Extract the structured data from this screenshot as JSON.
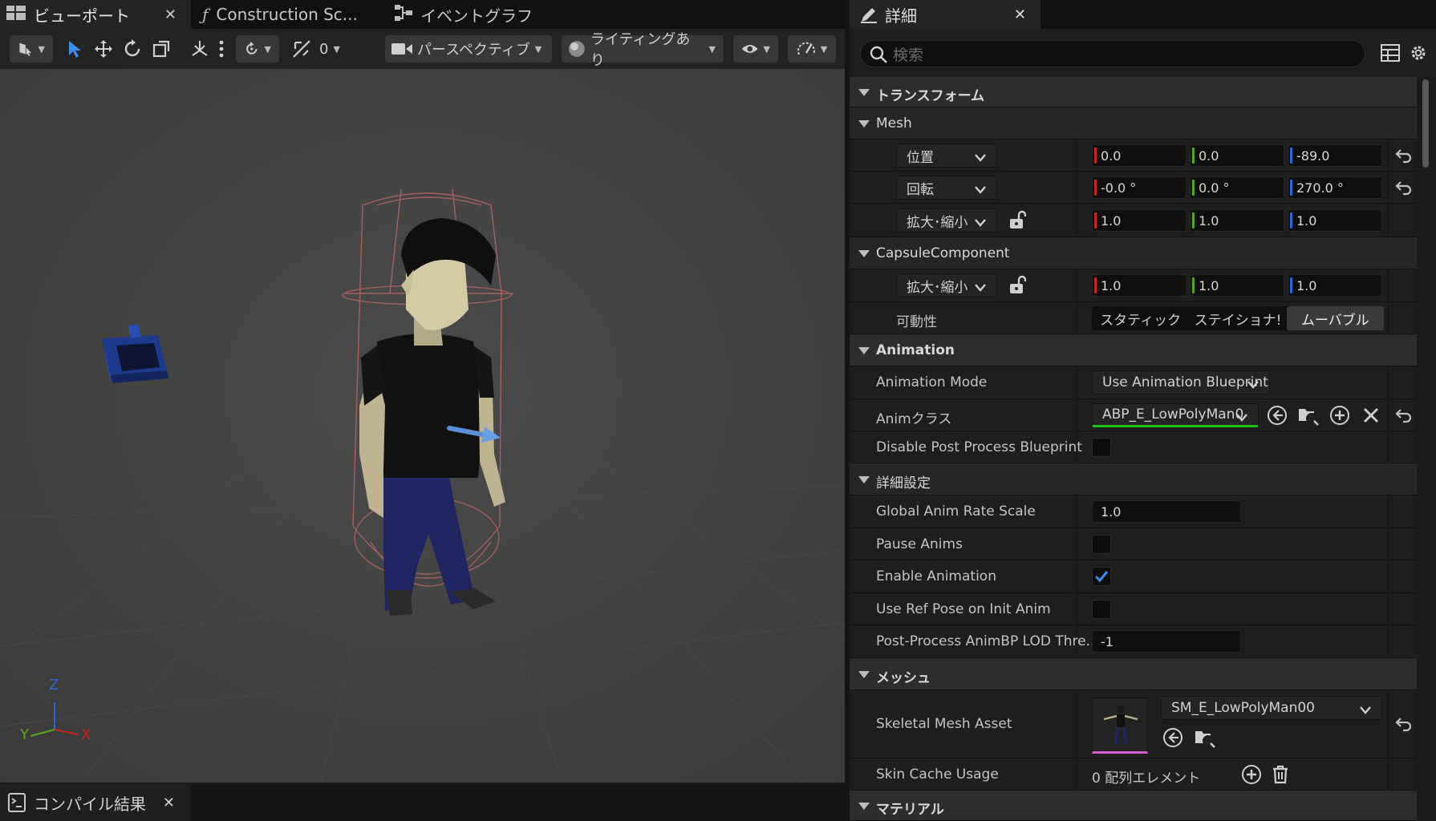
{
  "viewport_tabs": [
    {
      "label": "ビューポート"
    },
    {
      "label": "Construction Sc..."
    },
    {
      "label": "イベントグラフ"
    }
  ],
  "toolbar": {
    "snap_value": "0",
    "camera_mode": "パースペクティブ",
    "lighting_mode": "ライティングあり"
  },
  "axes": {
    "z": "Z",
    "y": "Y",
    "x": "X"
  },
  "bottom_tab": {
    "label": "コンパイル結果"
  },
  "details": {
    "tab_label": "詳細",
    "search_placeholder": "検索",
    "transform_section": "トランスフォーム",
    "mesh_sub": "Mesh",
    "location_label": "位置",
    "location": [
      "0.0",
      "0.0",
      "-89.0"
    ],
    "rotation_label": "回転",
    "rotation": [
      "-0.0 °",
      "0.0 °",
      "270.0 °"
    ],
    "scale_label": "拡大･縮小",
    "scale": [
      "1.0",
      "1.0",
      "1.0"
    ],
    "capsule_sub": "CapsuleComponent",
    "capsule_scale_label": "拡大･縮小",
    "capsule_scale": [
      "1.0",
      "1.0",
      "1.0"
    ],
    "mobility_label": "可動性",
    "mobility_options": [
      "スタティック",
      "ステイショナ!",
      "ムーバブル"
    ],
    "animation_section": "Animation",
    "animation_mode_label": "Animation Mode",
    "animation_mode_value": "Use Animation Blueprint",
    "anim_class_label": "Animクラス",
    "anim_class_value": "ABP_E_LowPolyMan0",
    "disable_post_process_label": "Disable Post Process Blueprint",
    "advanced_section": "詳細設定",
    "global_rate_label": "Global Anim Rate Scale",
    "global_rate_value": "1.0",
    "pause_anims_label": "Pause Anims",
    "enable_animation_label": "Enable Animation",
    "enable_animation_checked": true,
    "use_ref_pose_label": "Use Ref Pose on Init Anim",
    "lod_threshold_label": "Post-Process AnimBP LOD Thre...",
    "lod_threshold_value": "-1",
    "mesh_section": "メッシュ",
    "skeletal_mesh_label": "Skeletal Mesh Asset",
    "skeletal_mesh_value": "SM_E_LowPolyMan00",
    "skin_cache_label": "Skin Cache Usage",
    "skin_cache_value": "0 配列エレメント",
    "material_section": "マテリアル"
  },
  "colors": {
    "axis_x": "#c8241c",
    "axis_y": "#5ca81d",
    "axis_z": "#2a6ad8",
    "select_blue": "#3d8ef0",
    "anim_class_underline": "#22c01a"
  }
}
